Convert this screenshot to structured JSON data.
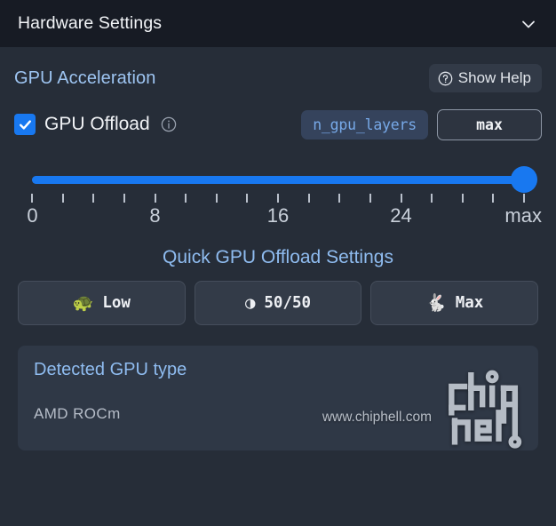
{
  "header": {
    "title": "Hardware Settings",
    "collapse_icon": "chevron-down-icon"
  },
  "section": {
    "title": "GPU Acceleration",
    "help_button": {
      "label": "Show Help",
      "icon": "question-circle-icon"
    }
  },
  "gpu_offload": {
    "checkbox_checked": true,
    "label": "GPU Offload",
    "info_icon": "info-circle-icon",
    "param_name": "n_gpu_layers",
    "value": "max"
  },
  "slider": {
    "value_label": "max",
    "percent": 100,
    "tick_count": 17,
    "tick_labels": [
      {
        "text": "0",
        "pos": 0
      },
      {
        "text": "8",
        "pos": 25
      },
      {
        "text": "16",
        "pos": 50
      },
      {
        "text": "24",
        "pos": 75
      },
      {
        "text": "max",
        "pos": 100
      }
    ]
  },
  "quick_settings": {
    "title": "Quick GPU Offload Settings",
    "buttons": [
      {
        "label": "Low",
        "icon": "turtle-icon",
        "glyph": "🐢"
      },
      {
        "label": "50/50",
        "icon": "half-moon-icon",
        "glyph": "◑"
      },
      {
        "label": "Max",
        "icon": "rabbit-icon",
        "glyph": "🐇"
      }
    ]
  },
  "detected_gpu": {
    "title": "Detected GPU type",
    "value": "AMD  ROCm"
  },
  "watermark": {
    "text": "www.chiphell.com",
    "logo": "chiphell-logo"
  },
  "colors": {
    "accent_blue": "#1878f0",
    "title_blue": "#8fbcf0",
    "panel_bg": "#2f3846",
    "body_bg": "#262d38",
    "header_bg": "#171b24"
  }
}
